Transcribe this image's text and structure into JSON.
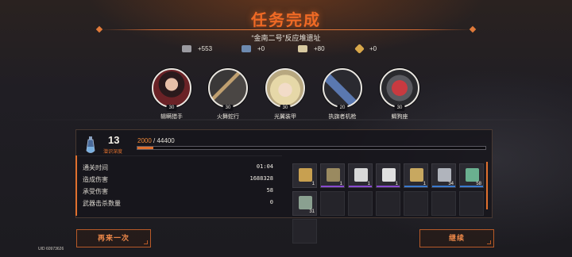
{
  "header": {
    "title": "任务完成",
    "subtitle": "“金南二号”反应堆遗址"
  },
  "currencies": [
    {
      "icon": "ticket-icon",
      "value": "+553",
      "color": "#9b9aa0"
    },
    {
      "icon": "blue-cube-icon",
      "value": "+0",
      "color": "#6d8ab0"
    },
    {
      "icon": "coin-bar-icon",
      "value": "+80",
      "color": "#d8c9a0"
    },
    {
      "icon": "gold-diamond-icon",
      "value": "+0",
      "color": "#d9a84a"
    }
  ],
  "characters": [
    {
      "name": "辑瞒猎手",
      "level": "30",
      "portrait": "dark-haired-girl-portrait",
      "color": "#5a2226"
    },
    {
      "name": "火舞蛇行",
      "level": "30",
      "portrait": "blade-weapon-portrait",
      "color": "#6a6460"
    },
    {
      "name": "光翼装甲",
      "level": "30",
      "portrait": "blonde-girl-portrait",
      "color": "#c8b890"
    },
    {
      "name": "执旗者机枪",
      "level": "20",
      "portrait": "machine-gun-portrait",
      "color": "#3a4a6a"
    },
    {
      "name": "蝎狗座",
      "level": "30",
      "portrait": "red-mech-portrait",
      "color": "#a0323a"
    }
  ],
  "depth": {
    "level": "13",
    "label": "潜识深度",
    "exp_current": "2000",
    "exp_separator": " / ",
    "exp_max": "44400",
    "progress": 0.045
  },
  "stats": [
    {
      "label": "通关时间",
      "value": "01:04"
    },
    {
      "label": "造成伤害",
      "value": "1688328"
    },
    {
      "label": "承受伤害",
      "value": "58"
    },
    {
      "label": "武器击杀数量",
      "value": "0"
    }
  ],
  "items": [
    {
      "name": "gold-chest-icon",
      "qty": "1",
      "color": "#c8a050",
      "rarity": ""
    },
    {
      "name": "purple-crate-icon",
      "qty": "1",
      "color": "#9a8a60",
      "rarity": "#8a4ad0"
    },
    {
      "name": "white-module-icon",
      "qty": "1",
      "color": "#d8d8d8",
      "rarity": "#8a4ad0"
    },
    {
      "name": "ab-module-icon",
      "qty": "1",
      "color": "#e0e0e0",
      "rarity": "#8a4ad0"
    },
    {
      "name": "gold-cube-icon",
      "qty": "1",
      "color": "#c8a860",
      "rarity": "#3a7ad0"
    },
    {
      "name": "silver-bar-icon",
      "qty": "34",
      "color": "#b0b4bc",
      "rarity": "#3a7ad0"
    },
    {
      "name": "green-canister-icon",
      "qty": "58",
      "color": "#6ab090",
      "rarity": "#3a7ad0"
    },
    {
      "name": "scrap-card-icon",
      "qty": "31",
      "color": "#8aa090",
      "rarity": ""
    }
  ],
  "empty_slots": 7,
  "buttons": {
    "retry": "再来一次",
    "continue": "继续"
  },
  "uid": "UID 60973626"
}
